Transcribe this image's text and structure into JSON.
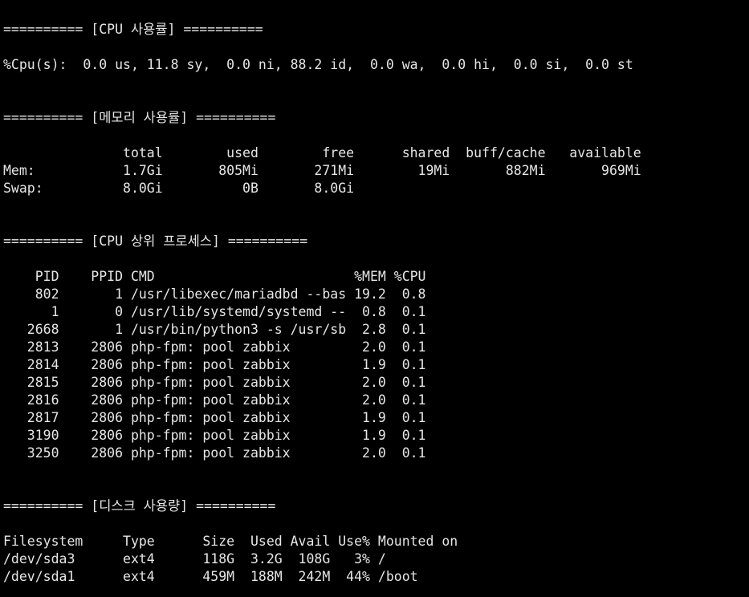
{
  "terminal": {
    "lines": [
      "========== [CPU 사용률] ==========",
      "",
      "%Cpu(s):  0.0 us, 11.8 sy,  0.0 ni, 88.2 id,  0.0 wa,  0.0 hi,  0.0 si,  0.0 st",
      "",
      "",
      "========== [메모리 사용률] ==========",
      "",
      "               total        used        free      shared  buff/cache   available",
      "Mem:           1.7Gi       805Mi       271Mi        19Mi       882Mi       969Mi",
      "Swap:          8.0Gi          0B       8.0Gi",
      "",
      "",
      "========== [CPU 상위 프로세스] ==========",
      "",
      "    PID    PPID CMD                         %MEM %CPU",
      "    802       1 /usr/libexec/mariadbd --bas 19.2  0.8",
      "      1       0 /usr/lib/systemd/systemd --  0.8  0.1",
      "   2668       1 /usr/bin/python3 -s /usr/sb  2.8  0.1",
      "   2813    2806 php-fpm: pool zabbix         2.0  0.1",
      "   2814    2806 php-fpm: pool zabbix         1.9  0.1",
      "   2815    2806 php-fpm: pool zabbix         2.0  0.1",
      "   2816    2806 php-fpm: pool zabbix         2.0  0.1",
      "   2817    2806 php-fpm: pool zabbix         1.9  0.1",
      "   3190    2806 php-fpm: pool zabbix         1.9  0.1",
      "   3250    2806 php-fpm: pool zabbix         2.0  0.1",
      "",
      "",
      "========== [디스크 사용량] ==========",
      "",
      "Filesystem     Type      Size  Used Avail Use% Mounted on",
      "/dev/sda3      ext4      118G  3.2G  108G   3% /",
      "/dev/sda1      ext4      459M  188M  242M  44% /boot"
    ]
  }
}
